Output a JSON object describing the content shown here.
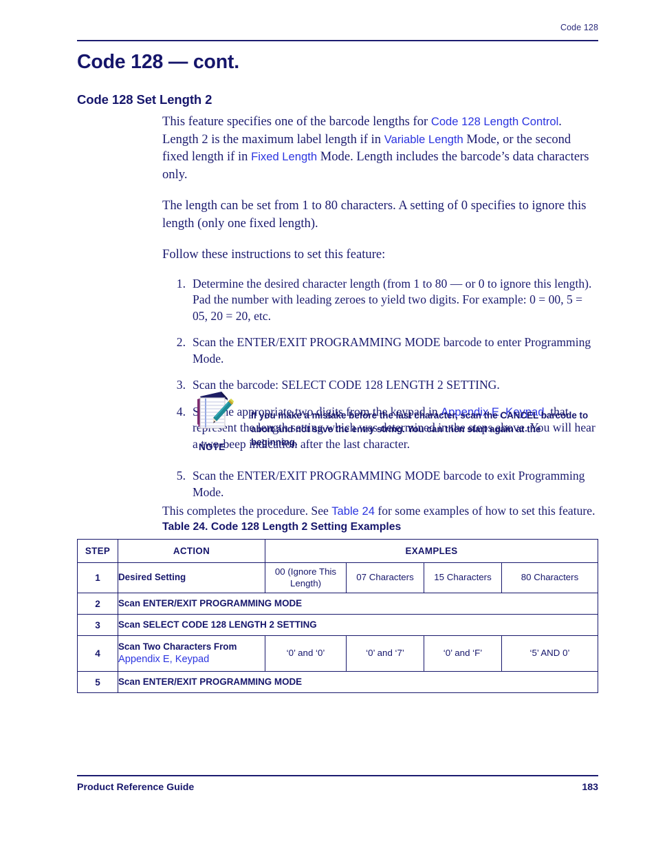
{
  "header": {
    "running_head": "Code 128"
  },
  "titles": {
    "chapter": "Code 128 — cont.",
    "section": "Code 128 Set Length 2"
  },
  "body": {
    "para1_a": "This feature specifies one of the barcode lengths for ",
    "para1_link1": "Code 128 Length Control",
    "para1_b": ". Length 2 is the maximum label length if in ",
    "para1_link2": "Variable Length",
    "para1_c": " Mode, or the second fixed length if in ",
    "para1_link3": "Fixed Length",
    "para1_d": " Mode. Length includes the barcode’s data characters only.",
    "para2": "The length can be set from 1 to 80 characters. A setting of 0 specifies to ignore this length (only one fixed length).",
    "para3": "Follow these instructions to set this feature:"
  },
  "steps": [
    {
      "num": "1.",
      "text": "Determine the desired character length (from 1 to 80 — or 0 to ignore this length). Pad the number with leading zeroes to yield two digits. For example: 0 = 00, 5 = 05, 20 = 20, etc."
    },
    {
      "num": "2.",
      "text": "Scan the ENTER/EXIT PROGRAMMING MODE barcode to enter Programming Mode."
    },
    {
      "num": "3.",
      "text": "Scan the barcode: SELECT CODE 128 LENGTH 2 SETTING."
    },
    {
      "num": "4.",
      "text_a": "Scan the appropriate two digits from the keypad in ",
      "link": "Appendix E, Keypad",
      "text_b": ", that represent the length setting which was determined in the steps above. You will hear a two-beep indication after the last character."
    }
  ],
  "note": {
    "label": "NOTE",
    "icon": "notepad-pencil-icon",
    "text": "If you make a mistake before the last character, scan the CANCEL barcode to abort and not save the entry string. You can then start again at the beginning."
  },
  "step5": {
    "num": "5.",
    "text": "Scan the ENTER/EXIT PROGRAMMING MODE barcode to exit Programming Mode."
  },
  "completes": {
    "text_a": "This completes the procedure. See ",
    "link": "Table 24",
    "text_b": " for some examples of how to set this feature."
  },
  "table": {
    "caption": "Table 24. Code 128 Length 2 Setting Examples",
    "headers": {
      "step": "STEP",
      "action": "ACTION",
      "examples": "EXAMPLES"
    },
    "rows": [
      {
        "step": "1",
        "action": "Desired Setting",
        "examples": [
          "00 (Ignore This Length)",
          "07 Characters",
          "15 Characters",
          "80 Characters"
        ]
      },
      {
        "step": "2",
        "action": "Scan ENTER/EXIT PROGRAMMING MODE",
        "examples": []
      },
      {
        "step": "3",
        "action": "Scan SELECT CODE 128 LENGTH 2 SETTING",
        "examples": []
      },
      {
        "step": "4",
        "action": "Scan Two Characters From",
        "action_link": "Appendix E, Keypad",
        "examples": [
          "‘0’ and ‘0’",
          "‘0’ and ‘7’",
          "‘0’ and ‘F’",
          "‘5’ AND 0’"
        ]
      },
      {
        "step": "5",
        "action": "Scan ENTER/EXIT PROGRAMMING MODE",
        "examples": []
      }
    ]
  },
  "footer": {
    "left": "Product Reference Guide",
    "page": "183"
  },
  "colors": {
    "navy": "#16166b",
    "body_navy": "#1b1b6f",
    "link_blue": "#2b34e0"
  }
}
